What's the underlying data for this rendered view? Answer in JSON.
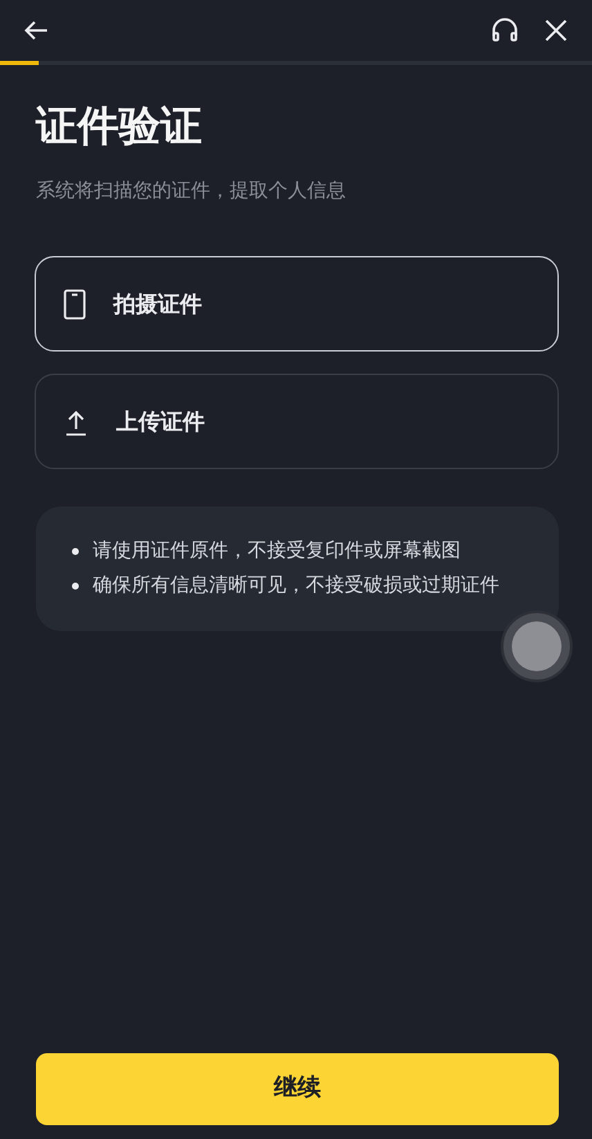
{
  "progress": {
    "level": 0.065
  },
  "title": "证件验证",
  "subtitle": "系统将扫描您的证件，提取个人信息",
  "options": [
    {
      "kind": "camera",
      "label": "拍摄证件",
      "selected": true
    },
    {
      "kind": "upload",
      "label": "上传证件",
      "selected": false
    }
  ],
  "tips": [
    "请使用证件原件，不接受复印件或屏幕截图",
    "确保所有信息清晰可见，不接受破损或过期证件"
  ],
  "primary_button": "继续"
}
